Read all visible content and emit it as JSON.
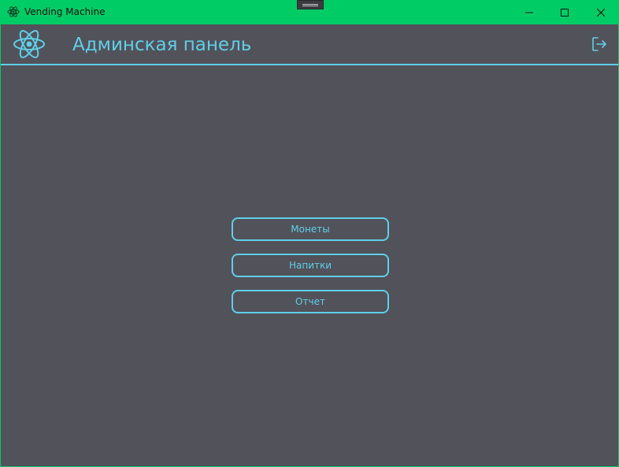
{
  "window": {
    "title": "Vending Machine",
    "titlebar_color": "#00cc66",
    "app_icon": "atom-icon",
    "controls": {
      "minimize_icon": "minimize-icon",
      "maximize_icon": "maximize-icon",
      "close_icon": "close-icon"
    }
  },
  "header": {
    "logo_icon": "atom-icon",
    "title": "Админская панель",
    "logout_icon": "logout-icon",
    "accent_color": "#5fcfe8"
  },
  "menu": {
    "items": [
      {
        "label": "Монеты"
      },
      {
        "label": "Напитки"
      },
      {
        "label": "Отчет"
      }
    ]
  },
  "colors": {
    "background": "#52525a",
    "accent": "#5fcfe8",
    "titlebar": "#00cc66"
  }
}
